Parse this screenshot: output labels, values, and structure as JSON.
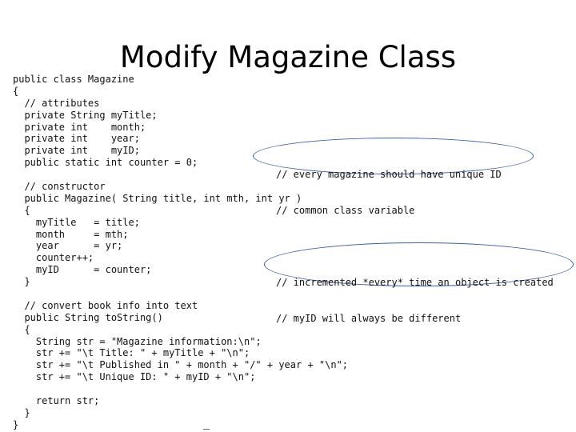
{
  "slide": {
    "title": "Modify Magazine Class"
  },
  "code_lines": [
    "public class Magazine",
    "{",
    "  // attributes",
    "  private String myTitle;",
    "  private int    month;",
    "  private int    year;",
    "  private int    myID;",
    "  public static int counter = 0;",
    "",
    "  // constructor",
    "  public Magazine( String title, int mth, int yr )",
    "  {",
    "    myTitle   = title;",
    "    month     = mth;",
    "    year      = yr;",
    "    counter++;",
    "    myID      = counter;",
    "  }",
    "",
    "  // convert book info into text",
    "  public String toString()",
    "  {",
    "    String str = \"Magazine information:\\n\";",
    "    str += \"\\t Title: \" + myTitle + \"\\n\";",
    "    str += \"\\t Published in \" + month + \"/\" + year + \"\\n\";",
    "    str += \"\\t Unique ID: \" + myID + \"\\n\";",
    "",
    "    return str;",
    "  }",
    "}"
  ],
  "callouts": [
    {
      "lines": [
        "// every magazine should have unique ID",
        "// common class variable"
      ]
    },
    {
      "lines": [
        "// incremented *every* time an object is created",
        "// myID will always be different"
      ]
    }
  ],
  "colors": {
    "ellipse_stroke": "#3a5fa8",
    "text": "#111111"
  }
}
